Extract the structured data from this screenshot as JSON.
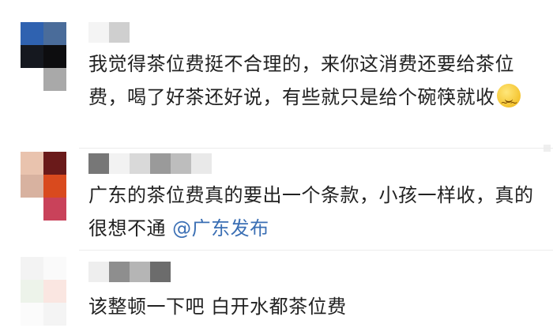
{
  "comments": [
    {
      "text": "我觉得茶位费挺不合理的，来你这消费还要给茶位费，喝了好茶还好说，有些就只是给个碗筷就收",
      "emoji": "smirk-emoji"
    },
    {
      "text": "广东的茶位费真的要出一个条款，小孩一样收，真的很想不通",
      "mention": "@广东发布"
    },
    {
      "text": "该整顿一下吧 白开水都茶位费"
    }
  ],
  "colors": {
    "text": "#222222",
    "mention": "#3b6fb4",
    "divider": "#ececec"
  }
}
